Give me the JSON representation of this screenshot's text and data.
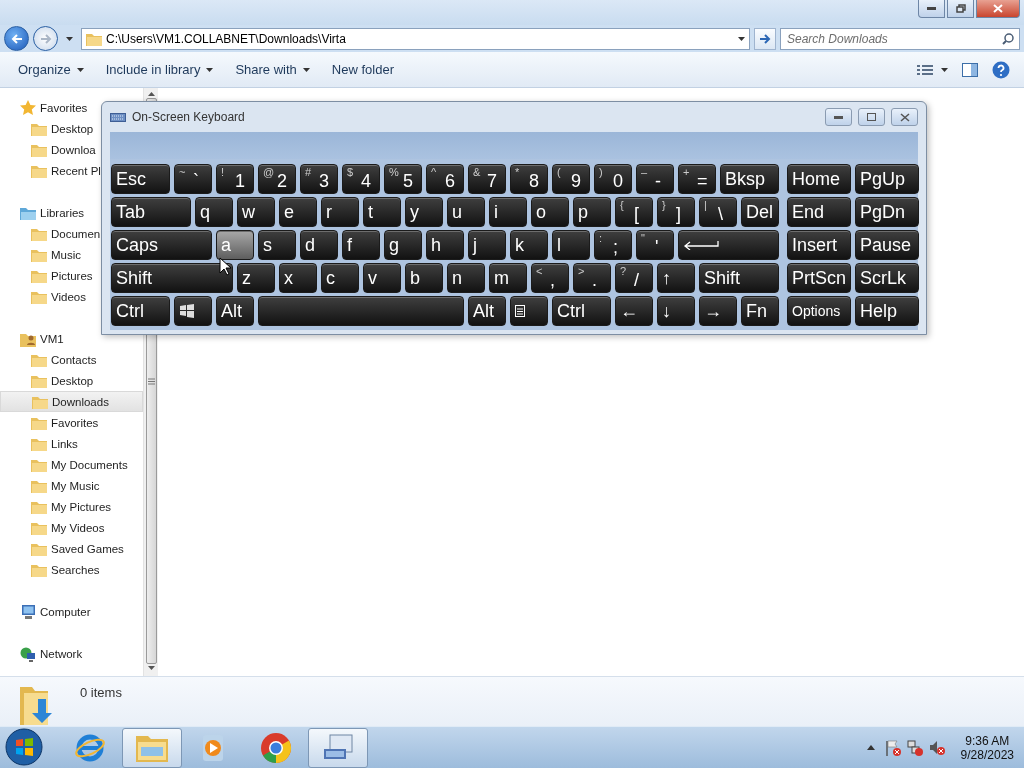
{
  "explorer": {
    "address": "C:\\Users\\VM1.COLLABNET\\Downloads\\Virta",
    "search": {
      "placeholder": "Search Downloads"
    },
    "toolbar": [
      {
        "label": "Organize",
        "dropdown": true
      },
      {
        "label": "Include in library",
        "dropdown": true
      },
      {
        "label": "Share with",
        "dropdown": true
      },
      {
        "label": "New folder",
        "dropdown": false
      }
    ],
    "sidebar": [
      {
        "label": "Favorites",
        "kind": "favorites",
        "selected": false,
        "children": [
          {
            "label": "Desktop",
            "selected": false
          },
          {
            "label": "Downloa",
            "selected": false
          },
          {
            "label": "Recent Pl",
            "selected": false
          }
        ]
      },
      {
        "label": "Libraries",
        "kind": "libraries",
        "selected": false,
        "children": [
          {
            "label": "Documen",
            "selected": false
          },
          {
            "label": "Music",
            "selected": false
          },
          {
            "label": "Pictures",
            "selected": false
          },
          {
            "label": "Videos",
            "selected": false
          }
        ]
      },
      {
        "label": "VM1",
        "kind": "user",
        "selected": false,
        "children": [
          {
            "label": "Contacts",
            "selected": false
          },
          {
            "label": "Desktop",
            "selected": false
          },
          {
            "label": "Downloads",
            "selected": true
          },
          {
            "label": "Favorites",
            "selected": false
          },
          {
            "label": "Links",
            "selected": false
          },
          {
            "label": "My Documents",
            "selected": false
          },
          {
            "label": "My Music",
            "selected": false
          },
          {
            "label": "My Pictures",
            "selected": false
          },
          {
            "label": "My Videos",
            "selected": false
          },
          {
            "label": "Saved Games",
            "selected": false
          },
          {
            "label": "Searches",
            "selected": false
          }
        ]
      },
      {
        "label": "Computer",
        "kind": "computer",
        "selected": false
      },
      {
        "label": "Network",
        "kind": "network",
        "selected": false
      }
    ],
    "status": "0 items"
  },
  "keyboard": {
    "title": "On-Screen Keyboard",
    "rows": [
      {
        "keys": [
          {
            "kind": "text",
            "label": "Esc",
            "hovered": false
          },
          {
            "kind": "dual",
            "shift": "~",
            "label": "`",
            "hovered": false
          },
          {
            "kind": "dual",
            "shift": "!",
            "label": "1",
            "hovered": false
          },
          {
            "kind": "dual",
            "shift": "@",
            "label": "2",
            "hovered": false
          },
          {
            "kind": "dual",
            "shift": "#",
            "label": "3",
            "hovered": false
          },
          {
            "kind": "dual",
            "shift": "$",
            "label": "4",
            "hovered": false
          },
          {
            "kind": "dual",
            "shift": "%",
            "label": "5",
            "hovered": false
          },
          {
            "kind": "dual",
            "shift": "^",
            "label": "6",
            "hovered": false
          },
          {
            "kind": "dual",
            "shift": "&",
            "label": "7",
            "hovered": false
          },
          {
            "kind": "dual",
            "shift": "*",
            "label": "8",
            "hovered": false
          },
          {
            "kind": "dual",
            "shift": "(",
            "label": "9",
            "hovered": false
          },
          {
            "kind": "dual",
            "shift": ")",
            "label": "0",
            "hovered": false
          },
          {
            "kind": "dual",
            "shift": "–",
            "label": "-",
            "hovered": false
          },
          {
            "kind": "dual",
            "shift": "+",
            "label": "=",
            "hovered": false
          },
          {
            "kind": "text",
            "label": "Bksp",
            "hovered": false
          }
        ]
      },
      {
        "keys": [
          {
            "kind": "text",
            "label": "Tab",
            "hovered": false
          },
          {
            "kind": "text",
            "label": "q",
            "hovered": false
          },
          {
            "kind": "text",
            "label": "w",
            "hovered": false
          },
          {
            "kind": "text",
            "label": "e",
            "hovered": false
          },
          {
            "kind": "text",
            "label": "r",
            "hovered": false
          },
          {
            "kind": "text",
            "label": "t",
            "hovered": false
          },
          {
            "kind": "text",
            "label": "y",
            "hovered": false
          },
          {
            "kind": "text",
            "label": "u",
            "hovered": false
          },
          {
            "kind": "text",
            "label": "i",
            "hovered": false
          },
          {
            "kind": "text",
            "label": "o",
            "hovered": false
          },
          {
            "kind": "text",
            "label": "p",
            "hovered": false
          },
          {
            "kind": "dual",
            "shift": "{",
            "label": "[",
            "hovered": false
          },
          {
            "kind": "dual",
            "shift": "}",
            "label": "]",
            "hovered": false
          },
          {
            "kind": "dual",
            "shift": "|",
            "label": "\\",
            "hovered": false
          },
          {
            "kind": "text",
            "label": "Del",
            "hovered": false
          }
        ]
      },
      {
        "keys": [
          {
            "kind": "text",
            "label": "Caps",
            "hovered": false
          },
          {
            "kind": "text",
            "label": "a",
            "hovered": true
          },
          {
            "kind": "text",
            "label": "s",
            "hovered": false
          },
          {
            "kind": "text",
            "label": "d",
            "hovered": false
          },
          {
            "kind": "text",
            "label": "f",
            "hovered": false
          },
          {
            "kind": "text",
            "label": "g",
            "hovered": false
          },
          {
            "kind": "text",
            "label": "h",
            "hovered": false
          },
          {
            "kind": "text",
            "label": "j",
            "hovered": false
          },
          {
            "kind": "text",
            "label": "k",
            "hovered": false
          },
          {
            "kind": "text",
            "label": "l",
            "hovered": false
          },
          {
            "kind": "dual",
            "shift": ":",
            "label": ";",
            "hovered": false
          },
          {
            "kind": "dual",
            "shift": "\"",
            "label": "'",
            "hovered": false
          },
          {
            "kind": "enter",
            "hovered": false
          }
        ]
      },
      {
        "keys": [
          {
            "kind": "text",
            "label": "Shift",
            "hovered": false
          },
          {
            "kind": "text",
            "label": "z",
            "hovered": false
          },
          {
            "kind": "text",
            "label": "x",
            "hovered": false
          },
          {
            "kind": "text",
            "label": "c",
            "hovered": false
          },
          {
            "kind": "text",
            "label": "v",
            "hovered": false
          },
          {
            "kind": "text",
            "label": "b",
            "hovered": false
          },
          {
            "kind": "text",
            "label": "n",
            "hovered": false
          },
          {
            "kind": "text",
            "label": "m",
            "hovered": false
          },
          {
            "kind": "dual",
            "shift": "<",
            "label": ",",
            "hovered": false
          },
          {
            "kind": "dual",
            "shift": ">",
            "label": ".",
            "hovered": false
          },
          {
            "kind": "dual",
            "shift": "?",
            "label": "/",
            "hovered": false
          },
          {
            "kind": "arrow",
            "label": "↑",
            "hovered": false
          },
          {
            "kind": "text",
            "label": "Shift",
            "hovered": false
          }
        ]
      },
      {
        "keys": [
          {
            "kind": "text",
            "label": "Ctrl",
            "hovered": false
          },
          {
            "kind": "windows",
            "hovered": false
          },
          {
            "kind": "text",
            "label": "Alt",
            "hovered": false
          },
          {
            "kind": "space",
            "hovered": false
          },
          {
            "kind": "text",
            "label": "Alt",
            "hovered": false
          },
          {
            "kind": "menu",
            "hovered": false
          },
          {
            "kind": "text",
            "label": "Ctrl",
            "hovered": false
          },
          {
            "kind": "arrow",
            "label": "←",
            "hovered": false
          },
          {
            "kind": "arrow",
            "label": "↓",
            "hovered": false
          },
          {
            "kind": "arrow",
            "label": "→",
            "hovered": false
          },
          {
            "kind": "text",
            "label": "Fn",
            "hovered": false
          }
        ]
      }
    ],
    "side_rows": [
      [
        "Home",
        "PgUp"
      ],
      [
        "End",
        "PgDn"
      ],
      [
        "Insert",
        "Pause"
      ],
      [
        "PrtScn",
        "ScrLk"
      ],
      [
        "Options",
        "Help"
      ]
    ]
  },
  "taskbar": {
    "apps": [
      {
        "kind": "browser-e",
        "active": false
      },
      {
        "kind": "folders",
        "active": true
      },
      {
        "kind": "player",
        "active": false
      },
      {
        "kind": "chrome",
        "active": false
      },
      {
        "kind": "keyboard",
        "active": true
      }
    ],
    "time": "9:36 AM",
    "date": "9/28/2023"
  }
}
